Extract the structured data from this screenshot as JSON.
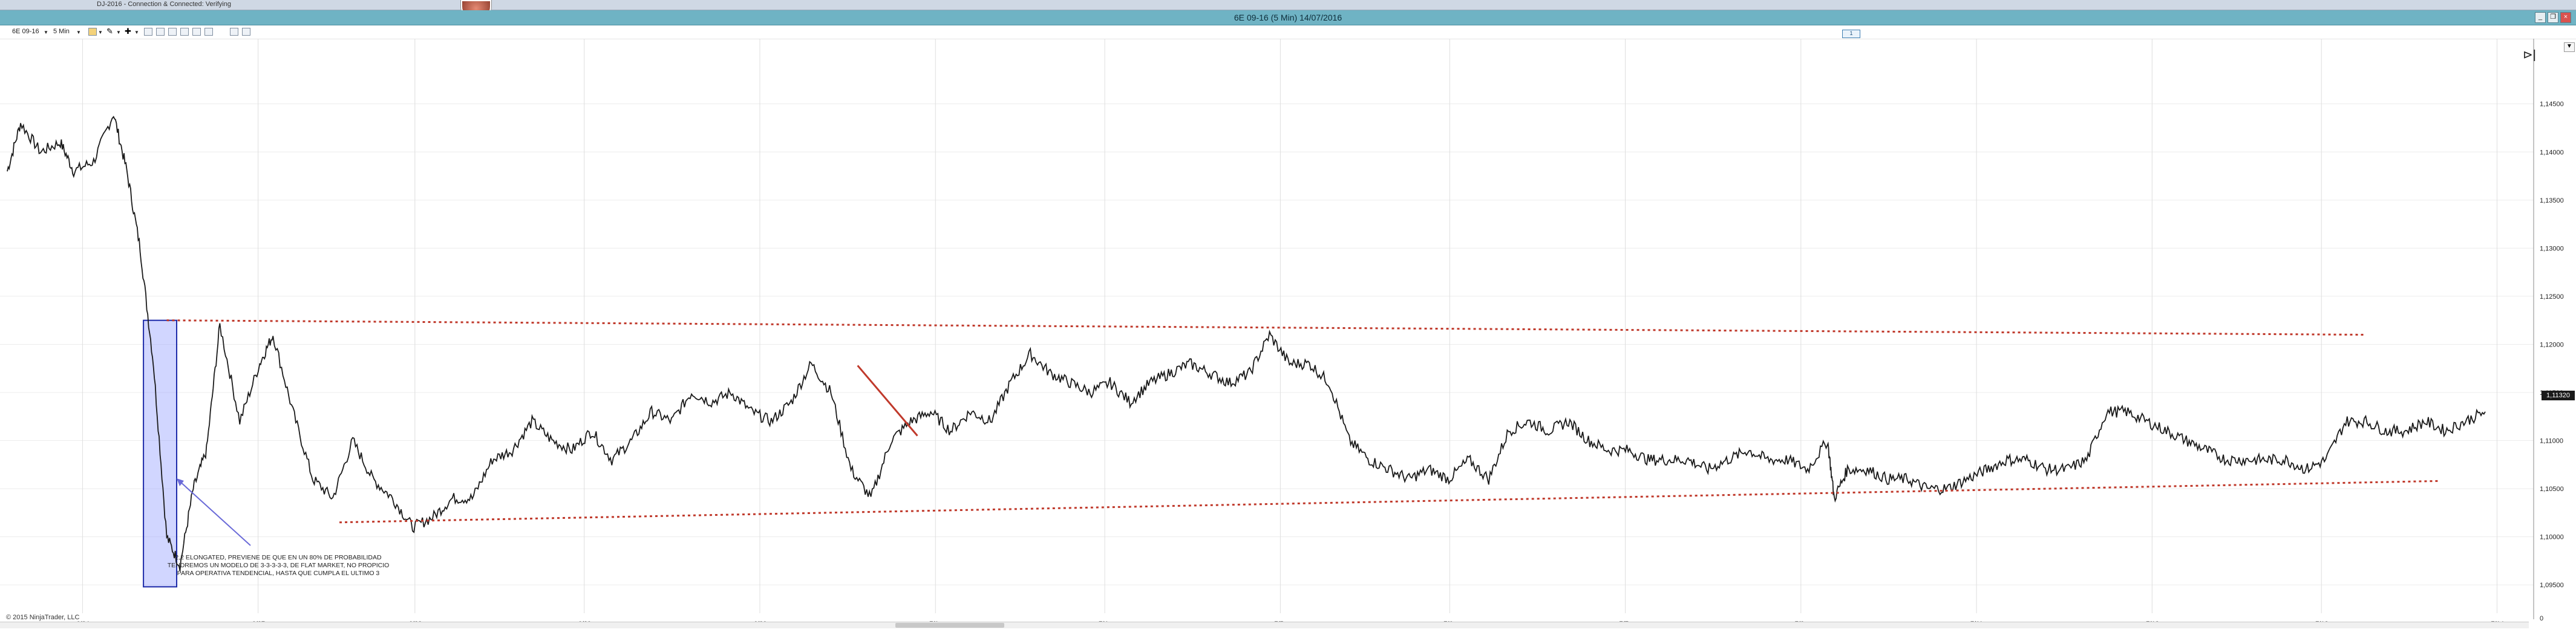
{
  "window": {
    "chart_title": "6E 09-16 (5 Min)  14/07/2016",
    "top_tab_text": "DJ-2016 - Connection & Connected: Verifying",
    "buttons": {
      "minimize": "_",
      "restore": "❐",
      "close": "×"
    }
  },
  "toolbar": {
    "instrument": "6E 09-16",
    "interval": "5 Min"
  },
  "panel_badge": "1",
  "annotation": {
    "text": "2,2 ELONGATED, PREVIENE DE QUE EN UN 80% DE PROBABILIDAD\nTENDREMOS UN MODELO DE 3-3-3-3-3, DE FLAT MARKET, NO PROPICIO\nPARA OPERATIVA TENDENCIAL, HASTA QUE CUMPLA EL ULTIMO 3"
  },
  "footer": {
    "copyright": "© 2015 NinjaTrader, LLC"
  },
  "price_axis": {
    "labels": [
      "1,14500",
      "1,14000",
      "1,13500",
      "1,13000",
      "1,12500",
      "1,12000",
      "1,11500",
      "1,11000",
      "1,10500",
      "1,10000",
      "1,09500",
      "0"
    ],
    "current_price": "1,11320"
  },
  "date_axis": {
    "labels": [
      "6/24",
      "6/27",
      "6/28",
      "6/29",
      "6/30",
      "7/1",
      "7/4",
      "7/5",
      "7/6",
      "7/7",
      "7/8",
      "7/11",
      "7/12",
      "7/13",
      "7/14"
    ]
  },
  "colors": {
    "chart_bar": "#6fb3c4",
    "trendline": "#c0392b",
    "highlight_box": "#9aa5ff",
    "arrow": "#6a6ad8",
    "candles": "#1a1a1a"
  },
  "chart_data": {
    "type": "line",
    "title": "6E 09-16 (5 Min)  14/07/2016",
    "xlabel": "",
    "ylabel": "",
    "ylim": [
      1.093,
      1.148
    ],
    "categories": [
      "6/24",
      "6/27",
      "6/28",
      "6/29",
      "6/30",
      "7/1",
      "7/4",
      "7/5",
      "7/6",
      "7/7",
      "7/8",
      "7/11",
      "7/12",
      "7/13",
      "7/14"
    ],
    "series": [
      {
        "values": [
          [
            0,
            1.138
          ],
          [
            0.2,
            1.143
          ],
          [
            0.5,
            1.14
          ],
          [
            0.8,
            1.141
          ],
          [
            1.0,
            1.138
          ],
          [
            1.3,
            1.139
          ],
          [
            1.6,
            1.144
          ],
          [
            1.8,
            1.138
          ],
          [
            2.0,
            1.13
          ],
          [
            2.2,
            1.118
          ],
          [
            2.4,
            1.1
          ],
          [
            2.6,
            1.097
          ],
          [
            2.8,
            1.105
          ],
          [
            3.0,
            1.109
          ],
          [
            3.2,
            1.122
          ],
          [
            3.5,
            1.112
          ],
          [
            3.8,
            1.118
          ],
          [
            4.0,
            1.121
          ],
          [
            4.3,
            1.113
          ],
          [
            4.6,
            1.106
          ],
          [
            4.9,
            1.104
          ],
          [
            5.2,
            1.11
          ],
          [
            5.5,
            1.106
          ],
          [
            5.8,
            1.104
          ],
          [
            6.1,
            1.101
          ],
          [
            6.4,
            1.102
          ],
          [
            6.7,
            1.104
          ],
          [
            7.0,
            1.104
          ],
          [
            7.3,
            1.108
          ],
          [
            7.6,
            1.109
          ],
          [
            7.9,
            1.112
          ],
          [
            8.2,
            1.11
          ],
          [
            8.5,
            1.109
          ],
          [
            8.8,
            1.111
          ],
          [
            9.1,
            1.108
          ],
          [
            9.4,
            1.11
          ],
          [
            9.7,
            1.113
          ],
          [
            10.0,
            1.112
          ],
          [
            10.3,
            1.115
          ],
          [
            10.6,
            1.114
          ],
          [
            10.9,
            1.115
          ],
          [
            11.2,
            1.113
          ],
          [
            11.5,
            1.112
          ],
          [
            11.8,
            1.114
          ],
          [
            12.1,
            1.118
          ],
          [
            12.4,
            1.115
          ],
          [
            12.7,
            1.107
          ],
          [
            13.0,
            1.104
          ],
          [
            13.3,
            1.11
          ],
          [
            13.6,
            1.112
          ],
          [
            13.9,
            1.113
          ],
          [
            14.2,
            1.111
          ],
          [
            14.5,
            1.113
          ],
          [
            14.8,
            1.112
          ],
          [
            15.1,
            1.116
          ],
          [
            15.4,
            1.119
          ],
          [
            15.7,
            1.117
          ],
          [
            16.0,
            1.116
          ],
          [
            16.3,
            1.115
          ],
          [
            16.6,
            1.116
          ],
          [
            16.9,
            1.114
          ],
          [
            17.2,
            1.116
          ],
          [
            17.5,
            1.117
          ],
          [
            17.8,
            1.118
          ],
          [
            18.1,
            1.117
          ],
          [
            18.4,
            1.116
          ],
          [
            18.7,
            1.117
          ],
          [
            19.0,
            1.121
          ],
          [
            19.3,
            1.118
          ],
          [
            19.6,
            1.118
          ],
          [
            19.9,
            1.116
          ],
          [
            20.2,
            1.11
          ],
          [
            20.5,
            1.108
          ],
          [
            20.8,
            1.107
          ],
          [
            21.1,
            1.106
          ],
          [
            21.4,
            1.107
          ],
          [
            21.7,
            1.106
          ],
          [
            22.0,
            1.108
          ],
          [
            22.3,
            1.106
          ],
          [
            22.6,
            1.111
          ],
          [
            22.9,
            1.112
          ],
          [
            23.2,
            1.111
          ],
          [
            23.5,
            1.112
          ],
          [
            23.8,
            1.11
          ],
          [
            24.1,
            1.109
          ],
          [
            24.4,
            1.109
          ],
          [
            24.7,
            1.108
          ],
          [
            25.0,
            1.108
          ],
          [
            25.3,
            1.108
          ],
          [
            25.6,
            1.107
          ],
          [
            25.9,
            1.108
          ],
          [
            26.2,
            1.109
          ],
          [
            26.5,
            1.108
          ],
          [
            26.8,
            1.108
          ],
          [
            27.1,
            1.107
          ],
          [
            27.4,
            1.11
          ],
          [
            27.5,
            1.104
          ],
          [
            27.7,
            1.107
          ],
          [
            28.0,
            1.107
          ],
          [
            28.3,
            1.106
          ],
          [
            28.6,
            1.106
          ],
          [
            28.9,
            1.105
          ],
          [
            29.2,
            1.105
          ],
          [
            29.5,
            1.106
          ],
          [
            29.8,
            1.107
          ],
          [
            30.1,
            1.108
          ],
          [
            30.4,
            1.108
          ],
          [
            30.7,
            1.107
          ],
          [
            31.0,
            1.107
          ],
          [
            31.3,
            1.108
          ],
          [
            31.6,
            1.113
          ],
          [
            31.9,
            1.113
          ],
          [
            32.2,
            1.112
          ],
          [
            32.5,
            1.111
          ],
          [
            32.8,
            1.11
          ],
          [
            33.1,
            1.109
          ],
          [
            33.4,
            1.108
          ],
          [
            33.7,
            1.108
          ],
          [
            34.0,
            1.108
          ],
          [
            34.3,
            1.108
          ],
          [
            34.6,
            1.107
          ],
          [
            34.9,
            1.108
          ],
          [
            35.2,
            1.112
          ],
          [
            35.5,
            1.112
          ],
          [
            35.8,
            1.111
          ],
          [
            36.1,
            1.111
          ],
          [
            36.4,
            1.112
          ],
          [
            36.7,
            1.111
          ],
          [
            37.0,
            1.112
          ],
          [
            37.3,
            1.113
          ]
        ]
      }
    ],
    "annotations": {
      "upper_trendline": [
        [
          2.4,
          1.1225
        ],
        [
          35.5,
          1.121
        ]
      ],
      "lower_trendline": [
        [
          5.0,
          1.1015
        ],
        [
          36.6,
          1.1058
        ]
      ],
      "short_trendline": [
        [
          12.8,
          1.1178
        ],
        [
          13.7,
          1.1105
        ]
      ],
      "highlight_box": {
        "x": [
          2.05,
          2.55
        ],
        "y": [
          1.0948,
          1.1225
        ]
      }
    }
  }
}
